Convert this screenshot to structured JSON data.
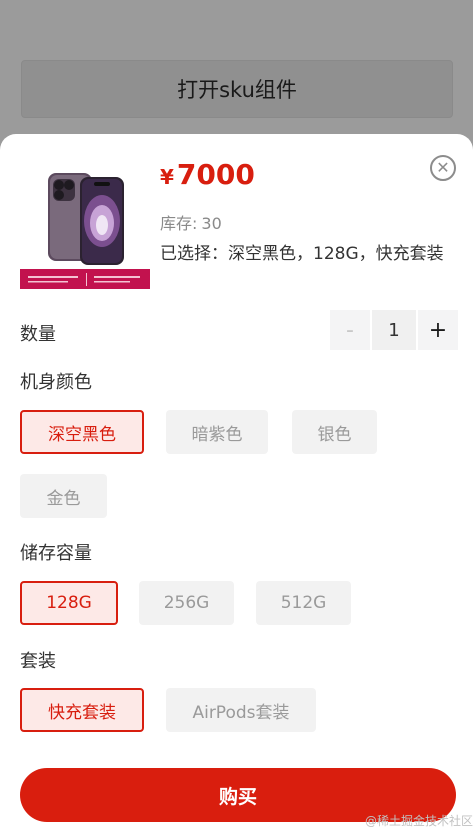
{
  "background": {
    "open_button_label": "打开sku组件"
  },
  "product": {
    "currency": "¥",
    "price": "7000",
    "stock_label": "库存:",
    "stock_value": "30",
    "selected_text": "已选择：深空黑色，128G，快充套装"
  },
  "quantity": {
    "label": "数量",
    "minus": "-",
    "value": "1",
    "plus": "+"
  },
  "groups": {
    "color": {
      "label": "机身颜色",
      "options": [
        "深空黑色",
        "暗紫色",
        "银色",
        "金色"
      ],
      "selected": "深空黑色"
    },
    "storage": {
      "label": "储存容量",
      "options": [
        "128G",
        "256G",
        "512G"
      ],
      "selected": "128G"
    },
    "bundle": {
      "label": "套装",
      "options": [
        "快充套装",
        "AirPods套装"
      ],
      "selected": "快充套装"
    }
  },
  "buy_button_label": "购买",
  "watermark": "@稀土掘金技术社区",
  "colors": {
    "accent": "#d81e0f",
    "accent_bg": "#fde9e7",
    "option_bg": "#f2f2f2"
  }
}
